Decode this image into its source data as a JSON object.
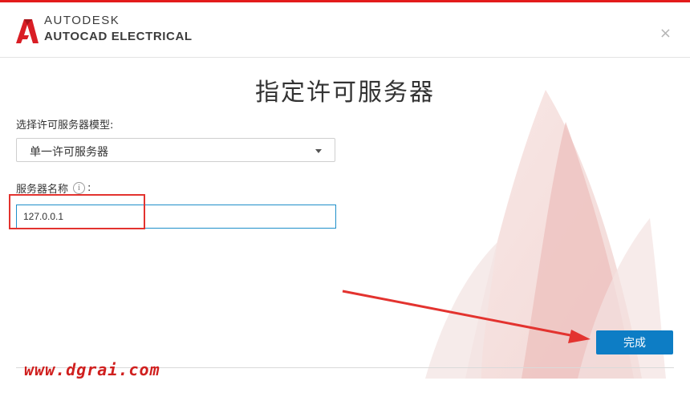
{
  "header": {
    "brand_line1": "AUTODESK",
    "brand_line2": "AUTOCAD ELECTRICAL",
    "close_symbol": "×"
  },
  "title": "指定许可服务器",
  "license_type": {
    "label": "选择许可服务器模型:",
    "selected": "单一许可服务器"
  },
  "server_name": {
    "label": "服务器名称",
    "info_symbol": "i",
    "colon": ":",
    "value": "127.0.0.1"
  },
  "finish_button": {
    "label": "完成"
  },
  "watermark": "www.dgrai.com",
  "colors": {
    "accent": "#0d7dc5",
    "annotation_red": "#e3332f",
    "logo_red": "#d91e25"
  }
}
